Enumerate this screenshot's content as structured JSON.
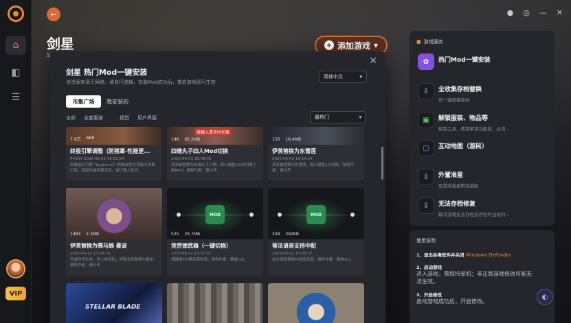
{
  "header": {
    "title": "剑星",
    "subtitle": "S",
    "add_game_label": "添加游戏"
  },
  "modal": {
    "title": "剑星 热门Mod一键安装",
    "desc": "该资源来源于网络，请自行选择，安装Mod成功后，重启游戏即可生效",
    "language": "简体中文",
    "tabs": [
      "市集广场",
      "我安装的"
    ],
    "categories": [
      "全部",
      "全套服装",
      "视觉",
      "用户界面"
    ],
    "sort": "最热门",
    "cards": [
      {
        "name": "终极引擎调整（防猪罩-性能更...",
        "meta": "P4G0X  2025-06-02 19:52:54",
        "desc": "权威虚幻引擎 \"Engine.ini\" 的更改旨在消除大多数口吃，提高性能和稳定性，减少输入延迟...",
        "stat1": "7.9万",
        "stat2": "6KB"
      },
      {
        "name": "四维丸子四人Mod切换",
        "meta": "2025-06-03 15:08:03",
        "desc": "伊芙被替换为四维丸子人物，按小键盘1234切换人物Mod；授权作者：德小卒",
        "stat1": "146",
        "stat2": "62.2MB",
        "banner": "接触入青实时切换"
      },
      {
        "name": "伊芙替换为东雪莲",
        "meta": "2025-06-03 16:14:24",
        "desc": "伊芙被替换为东雪莲，按小键盘1/2切换；授权作者：德小卒",
        "stat1": "135",
        "stat2": "18.4MB"
      },
      {
        "name": "伊芙替换为赛马娘 曼波",
        "meta": "2025-06-13 17:19:26",
        "desc": "安装即可生效，进入游戏后，伊芙全部替换为曼波；授权作者：德小卒",
        "stat1": "1483",
        "stat2": "2.3MB"
      },
      {
        "name": "竞劳德武器（一键切换）",
        "meta": "2025-06-12 11:57:37",
        "desc": "按键盘P切换武器外观；授权作者：离城101",
        "stat1": "525",
        "stat2": "25.7MB"
      },
      {
        "name": "蒂法语音支持中配",
        "meta": "2025-06-12 11:55:27",
        "desc": "战斗语音替换并追加语音；授权作者：离城101",
        "stat1": "309",
        "stat2": "292KB"
      }
    ],
    "bottom_card_text": "STELLAR BLADE"
  },
  "services": {
    "heading": "游戏服务",
    "items": [
      {
        "title": "热门Mod一键安装",
        "desc": ""
      },
      {
        "title": "全收集存档替换",
        "desc": "可一键替换存档"
      },
      {
        "title": "解锁服装、物品等",
        "desc": "解锁工具，使用解锁功能前，必须..."
      },
      {
        "title": "互动地图（游民）",
        "desc": ""
      },
      {
        "title": "外置准星",
        "desc": "是游戏准星精准锁敌"
      },
      {
        "title": "无法存档修复",
        "desc": "解决游戏无法存档及存档时出现问..."
      }
    ]
  },
  "guide": {
    "heading": "使用说明",
    "step1_label": "1、退出杀毒软件并关闭",
    "step1_org": "Windows Defender",
    "step2_label": "2、启动游戏",
    "step2_text": "进入游戏，需保持单机；非正版游戏修改可能无法生效。",
    "step3_label": "3、开启修改",
    "step3_text": "启动游戏成功后，开启修改。"
  },
  "icons": {
    "brand": "#f08a32",
    "accent_green": "#5fd37a",
    "orange_text": "#e58a3a"
  }
}
